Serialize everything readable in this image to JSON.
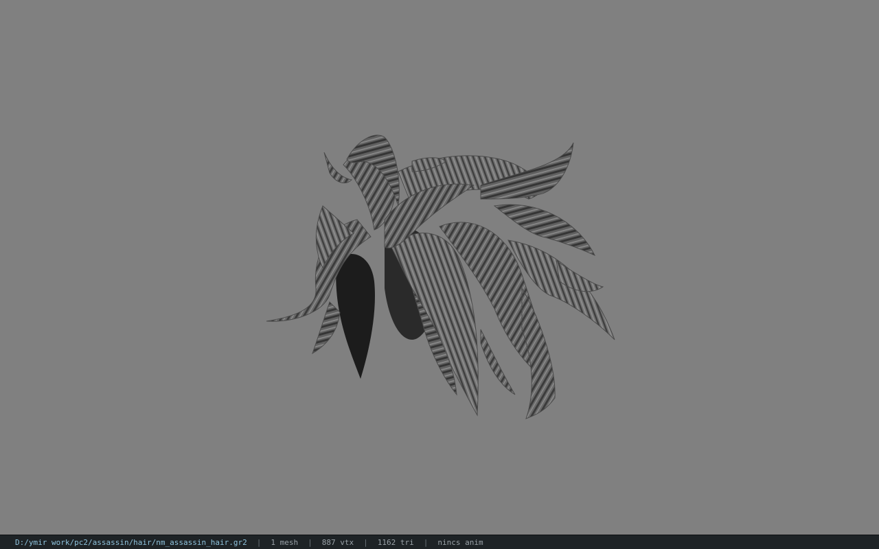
{
  "viewport": {
    "background_color": "#808080",
    "model_name": "nm_assassin_hair"
  },
  "status_bar": {
    "file_path": "D:/ymir work/pc2/assassin/hair/nm_assassin_hair.gr2",
    "separator": "|",
    "mesh_count": "1 mesh",
    "vertex_count": "887 vtx",
    "triangle_count": "1162 tri",
    "animation": "nincs anim",
    "path_color": "#8fc3dd",
    "stat_color": "#9aa2a8"
  }
}
